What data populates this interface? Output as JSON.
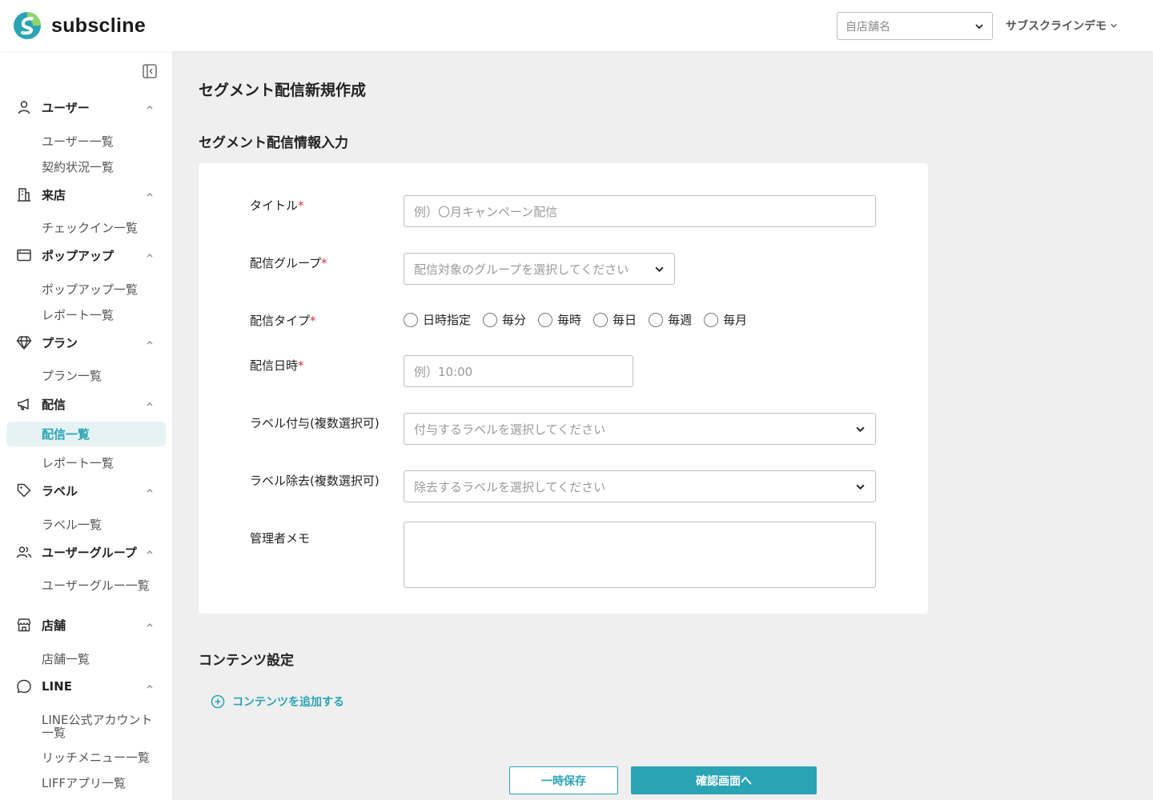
{
  "header": {
    "logo_text": "subscline",
    "store_select_placeholder": "自店舗名",
    "account_name": "サブスクラインデモ",
    "brand_color": "#2aa4b4"
  },
  "sidebar": {
    "groups": [
      {
        "label": "ユーザー",
        "icon": "person-icon",
        "items": [
          "ユーザー一覧",
          "契約状況一覧"
        ]
      },
      {
        "label": "来店",
        "icon": "building-icon",
        "items": [
          "チェックイン一覧"
        ]
      },
      {
        "label": "ポップアップ",
        "icon": "window-icon",
        "items": [
          "ポップアップ一覧",
          "レポート一覧"
        ]
      },
      {
        "label": "プラン",
        "icon": "diamond-icon",
        "items": [
          "プラン一覧"
        ]
      },
      {
        "label": "配信",
        "icon": "megaphone-icon",
        "items": [
          "配信一覧",
          "レポート一覧"
        ]
      },
      {
        "label": "ラベル",
        "icon": "tag-icon",
        "items": [
          "ラベル一覧"
        ]
      },
      {
        "label": "ユーザーグループ",
        "icon": "users-icon",
        "items": [
          "ユーザーグルー一覧"
        ]
      },
      {
        "label": "店舗",
        "icon": "store-icon",
        "items": [
          "店舗一覧"
        ]
      },
      {
        "label": "LINE",
        "icon": "chat-bubble-icon",
        "items": [
          "LINE公式アカウント一覧",
          "リッチメニュー一覧",
          "LIFFアプリ一覧"
        ]
      }
    ],
    "active_item": "配信一覧"
  },
  "main": {
    "page_title": "セグメント配信新規作成",
    "info_section_title": "セグメント配信情報入力",
    "form": {
      "title_label": "タイトル",
      "title_placeholder": "例）〇月キャンペーン配信",
      "group_label": "配信グループ",
      "group_placeholder": "配信対象のグループを選択してください",
      "type_label": "配信タイプ",
      "type_options": [
        "日時指定",
        "毎分",
        "毎時",
        "毎日",
        "毎週",
        "毎月"
      ],
      "datetime_label": "配信日時",
      "datetime_placeholder": "例）10:00",
      "label_add_label": "ラベル付与(複数選択可)",
      "label_add_placeholder": "付与するラベルを選択してください",
      "label_remove_label": "ラベル除去(複数選択可)",
      "label_remove_placeholder": "除去するラベルを選択してください",
      "memo_label": "管理者メモ",
      "memo_value": "",
      "required_mark": "*"
    },
    "content_section_title": "コンテンツ設定",
    "add_content_label": "コンテンツを追加する",
    "buttons": {
      "temp_save": "一時保存",
      "confirm": "確認画面へ"
    }
  }
}
